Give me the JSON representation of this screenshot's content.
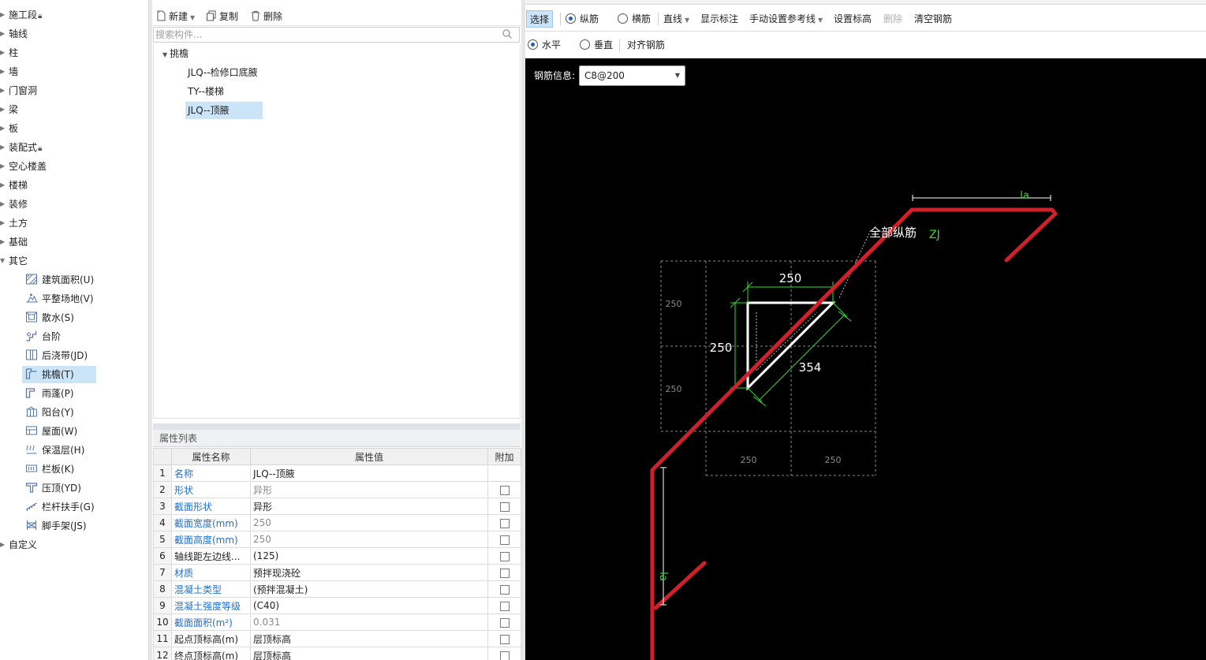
{
  "left_tree": {
    "categories_top": [
      {
        "label": "施工段",
        "lock": true
      },
      {
        "label": "轴线"
      },
      {
        "label": "柱"
      },
      {
        "label": "墙"
      },
      {
        "label": "门窗洞"
      },
      {
        "label": "梁"
      },
      {
        "label": "板"
      },
      {
        "label": "装配式",
        "lock": true
      },
      {
        "label": "空心楼盖"
      },
      {
        "label": "楼梯"
      },
      {
        "label": "装修"
      },
      {
        "label": "土方"
      },
      {
        "label": "基础"
      },
      {
        "label": "其它"
      }
    ],
    "other_children": [
      {
        "label": "建筑面积(U)",
        "icon": "building-area-icon"
      },
      {
        "label": "平整场地(V)",
        "icon": "site-leveling-icon"
      },
      {
        "label": "散水(S)",
        "icon": "apron-icon"
      },
      {
        "label": "台阶",
        "icon": "steps-icon"
      },
      {
        "label": "后浇带(JD)",
        "icon": "post-cast-strip-icon"
      },
      {
        "label": "挑檐(T)",
        "icon": "cornice-icon",
        "selected": true
      },
      {
        "label": "雨蓬(P)",
        "icon": "canopy-icon"
      },
      {
        "label": "阳台(Y)",
        "icon": "balcony-icon"
      },
      {
        "label": "屋面(W)",
        "icon": "roof-icon"
      },
      {
        "label": "保温层(H)",
        "icon": "insulation-icon"
      },
      {
        "label": "栏板(K)",
        "icon": "parapet-icon"
      },
      {
        "label": "压顶(YD)",
        "icon": "coping-icon"
      },
      {
        "label": "栏杆扶手(G)",
        "icon": "railing-icon"
      },
      {
        "label": "脚手架(JS)",
        "icon": "scaffold-icon"
      }
    ],
    "custom": "自定义"
  },
  "mid_toolbar": {
    "new_label": "新建",
    "copy_label": "复制",
    "delete_label": "删除"
  },
  "search": {
    "placeholder": "搜索构件..."
  },
  "component_tree": {
    "root": "挑檐",
    "items": [
      {
        "label": "JLQ--检修口底腋"
      },
      {
        "label": "TY--楼梯"
      },
      {
        "label": "JLQ--顶腋",
        "selected": true
      }
    ]
  },
  "properties": {
    "title": "属性列表",
    "headers": [
      "属性名称",
      "属性值",
      "附加"
    ],
    "rows": [
      {
        "n": "1",
        "name": "名称",
        "value": "JLQ--顶腋",
        "blue": true,
        "gray": false,
        "check": false
      },
      {
        "n": "2",
        "name": "形状",
        "value": "异形",
        "blue": true,
        "gray": true,
        "check": true
      },
      {
        "n": "3",
        "name": "截面形状",
        "value": "异形",
        "blue": true,
        "gray": false,
        "check": true
      },
      {
        "n": "4",
        "name": "截面宽度(mm)",
        "value": "250",
        "blue": true,
        "gray": true,
        "check": true
      },
      {
        "n": "5",
        "name": "截面高度(mm)",
        "value": "250",
        "blue": true,
        "gray": true,
        "check": true
      },
      {
        "n": "6",
        "name": "轴线距左边线...",
        "value": "(125)",
        "blue": false,
        "gray": false,
        "check": true
      },
      {
        "n": "7",
        "name": "材质",
        "value": "预拌现浇砼",
        "blue": true,
        "gray": false,
        "check": true
      },
      {
        "n": "8",
        "name": "混凝土类型",
        "value": "(预拌混凝土)",
        "blue": true,
        "gray": false,
        "check": true
      },
      {
        "n": "9",
        "name": "混凝土强度等级",
        "value": "(C40)",
        "blue": true,
        "gray": false,
        "check": true
      },
      {
        "n": "10",
        "name": "截面面积(m²)",
        "value": "0.031",
        "blue": true,
        "gray": true,
        "check": true
      },
      {
        "n": "11",
        "name": "起点顶标高(m)",
        "value": "层顶标高",
        "blue": false,
        "gray": false,
        "check": true
      },
      {
        "n": "12",
        "name": "终点顶标高(m)",
        "value": "层顶标高",
        "blue": false,
        "gray": false,
        "check": true
      }
    ]
  },
  "right_toolbar1": {
    "select": "选择",
    "longitudinal": "纵筋",
    "transverse": "横筋",
    "line": "直线",
    "show_dims": "显示标注",
    "manual_ref": "手动设置参考线",
    "set_elevation": "设置标高",
    "delete": "删除",
    "clear_rebar": "清空钢筋"
  },
  "right_toolbar2": {
    "horizontal": "水平",
    "vertical": "垂直",
    "align_rebar": "对齐钢筋"
  },
  "canvas": {
    "rebar_info_label": "钢筋信息:",
    "rebar_info_value": "C8@200",
    "dim_top": "250",
    "dim_left": "250",
    "dim_diag": "354",
    "grid_left_top": "250",
    "grid_left_bottom": "250",
    "grid_bottom_left": "250",
    "grid_bottom_right": "250",
    "rebar_annotation": "全部纵筋",
    "rebar_code": "ZJ",
    "anchor_top": "la",
    "anchor_left": "la",
    "colors": {
      "rebar": "#d0202a",
      "dim": "#2fe02f",
      "shape": "#ffffff",
      "grid": "#8a8a8a"
    }
  }
}
